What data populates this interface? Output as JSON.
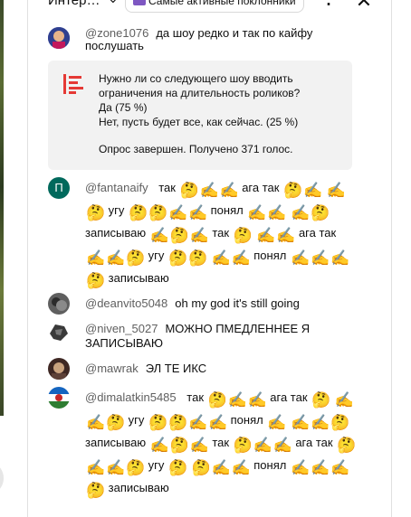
{
  "header": {
    "title": "Интер…",
    "filter_label": "Самые активные поклонники",
    "more_icon": "more-vert-icon",
    "close_icon": "close-icon"
  },
  "poll": {
    "question": "Нужно ли со следующего шоу вводить ограничения на длительность роликов?",
    "option1": "Да (75 %)",
    "option2": "Нет, пусть будет все, как сейчас. (25 %)",
    "status": "Опрос завершен. Получено 371 голос.",
    "accent_color": "#e53935"
  },
  "messages": [
    {
      "author": "@zone1076",
      "text": "да шоу редко и так по кайфу послушать"
    },
    {
      "author": "@fantanaify",
      "avatar_letter": "П",
      "avatar_color": "#00695c"
    },
    {
      "author": "@deanvito5048",
      "text": "oh my god it's still going"
    },
    {
      "author": "@niven_5027",
      "text": "МОЖНО ПМЕДЛЕННЕЕ Я ЗАПИСЫВАЮ"
    },
    {
      "author": "@mawrak",
      "text": "ЭЛ ТЕ ИКС"
    },
    {
      "author": "@dimalatkin5485"
    }
  ],
  "words": {
    "tak": "так",
    "aga_tak": "ага так",
    "ugu": "угу",
    "ponyal": "понял",
    "zapisyvayu": "записываю"
  },
  "emoji": {
    "thinking": "🤔",
    "writing": "✍️"
  },
  "scrollbar": {
    "up_icon": "arrow-up-icon",
    "down_icon": "arrow-down-icon"
  }
}
